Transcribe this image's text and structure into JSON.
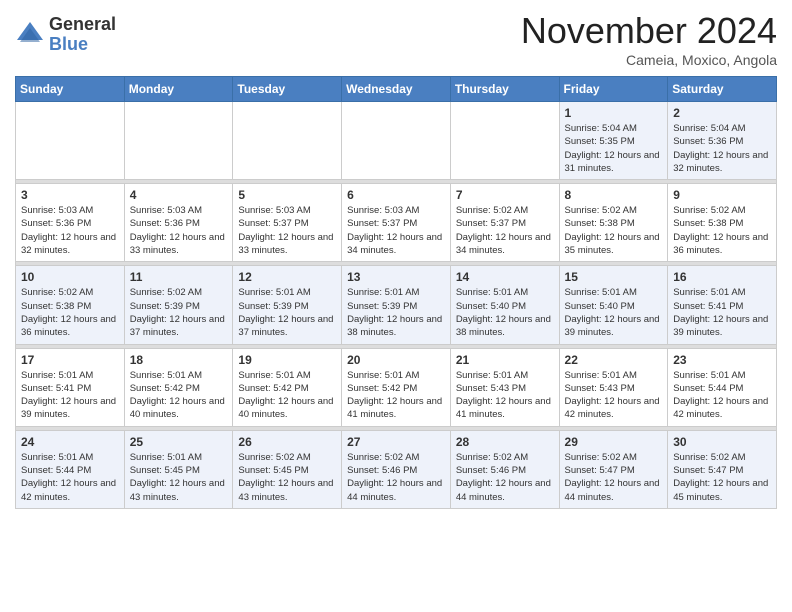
{
  "logo": {
    "general": "General",
    "blue": "Blue"
  },
  "title": "November 2024",
  "location": "Cameia, Moxico, Angola",
  "days_of_week": [
    "Sunday",
    "Monday",
    "Tuesday",
    "Wednesday",
    "Thursday",
    "Friday",
    "Saturday"
  ],
  "weeks": [
    [
      {
        "day": "",
        "info": ""
      },
      {
        "day": "",
        "info": ""
      },
      {
        "day": "",
        "info": ""
      },
      {
        "day": "",
        "info": ""
      },
      {
        "day": "",
        "info": ""
      },
      {
        "day": "1",
        "sunrise": "5:04 AM",
        "sunset": "5:35 PM",
        "daylight": "12 hours and 31 minutes."
      },
      {
        "day": "2",
        "sunrise": "5:04 AM",
        "sunset": "5:36 PM",
        "daylight": "12 hours and 32 minutes."
      }
    ],
    [
      {
        "day": "3",
        "sunrise": "5:03 AM",
        "sunset": "5:36 PM",
        "daylight": "12 hours and 32 minutes."
      },
      {
        "day": "4",
        "sunrise": "5:03 AM",
        "sunset": "5:36 PM",
        "daylight": "12 hours and 33 minutes."
      },
      {
        "day": "5",
        "sunrise": "5:03 AM",
        "sunset": "5:37 PM",
        "daylight": "12 hours and 33 minutes."
      },
      {
        "day": "6",
        "sunrise": "5:03 AM",
        "sunset": "5:37 PM",
        "daylight": "12 hours and 34 minutes."
      },
      {
        "day": "7",
        "sunrise": "5:02 AM",
        "sunset": "5:37 PM",
        "daylight": "12 hours and 34 minutes."
      },
      {
        "day": "8",
        "sunrise": "5:02 AM",
        "sunset": "5:38 PM",
        "daylight": "12 hours and 35 minutes."
      },
      {
        "day": "9",
        "sunrise": "5:02 AM",
        "sunset": "5:38 PM",
        "daylight": "12 hours and 36 minutes."
      }
    ],
    [
      {
        "day": "10",
        "sunrise": "5:02 AM",
        "sunset": "5:38 PM",
        "daylight": "12 hours and 36 minutes."
      },
      {
        "day": "11",
        "sunrise": "5:02 AM",
        "sunset": "5:39 PM",
        "daylight": "12 hours and 37 minutes."
      },
      {
        "day": "12",
        "sunrise": "5:01 AM",
        "sunset": "5:39 PM",
        "daylight": "12 hours and 37 minutes."
      },
      {
        "day": "13",
        "sunrise": "5:01 AM",
        "sunset": "5:39 PM",
        "daylight": "12 hours and 38 minutes."
      },
      {
        "day": "14",
        "sunrise": "5:01 AM",
        "sunset": "5:40 PM",
        "daylight": "12 hours and 38 minutes."
      },
      {
        "day": "15",
        "sunrise": "5:01 AM",
        "sunset": "5:40 PM",
        "daylight": "12 hours and 39 minutes."
      },
      {
        "day": "16",
        "sunrise": "5:01 AM",
        "sunset": "5:41 PM",
        "daylight": "12 hours and 39 minutes."
      }
    ],
    [
      {
        "day": "17",
        "sunrise": "5:01 AM",
        "sunset": "5:41 PM",
        "daylight": "12 hours and 39 minutes."
      },
      {
        "day": "18",
        "sunrise": "5:01 AM",
        "sunset": "5:42 PM",
        "daylight": "12 hours and 40 minutes."
      },
      {
        "day": "19",
        "sunrise": "5:01 AM",
        "sunset": "5:42 PM",
        "daylight": "12 hours and 40 minutes."
      },
      {
        "day": "20",
        "sunrise": "5:01 AM",
        "sunset": "5:42 PM",
        "daylight": "12 hours and 41 minutes."
      },
      {
        "day": "21",
        "sunrise": "5:01 AM",
        "sunset": "5:43 PM",
        "daylight": "12 hours and 41 minutes."
      },
      {
        "day": "22",
        "sunrise": "5:01 AM",
        "sunset": "5:43 PM",
        "daylight": "12 hours and 42 minutes."
      },
      {
        "day": "23",
        "sunrise": "5:01 AM",
        "sunset": "5:44 PM",
        "daylight": "12 hours and 42 minutes."
      }
    ],
    [
      {
        "day": "24",
        "sunrise": "5:01 AM",
        "sunset": "5:44 PM",
        "daylight": "12 hours and 42 minutes."
      },
      {
        "day": "25",
        "sunrise": "5:01 AM",
        "sunset": "5:45 PM",
        "daylight": "12 hours and 43 minutes."
      },
      {
        "day": "26",
        "sunrise": "5:02 AM",
        "sunset": "5:45 PM",
        "daylight": "12 hours and 43 minutes."
      },
      {
        "day": "27",
        "sunrise": "5:02 AM",
        "sunset": "5:46 PM",
        "daylight": "12 hours and 44 minutes."
      },
      {
        "day": "28",
        "sunrise": "5:02 AM",
        "sunset": "5:46 PM",
        "daylight": "12 hours and 44 minutes."
      },
      {
        "day": "29",
        "sunrise": "5:02 AM",
        "sunset": "5:47 PM",
        "daylight": "12 hours and 44 minutes."
      },
      {
        "day": "30",
        "sunrise": "5:02 AM",
        "sunset": "5:47 PM",
        "daylight": "12 hours and 45 minutes."
      }
    ]
  ],
  "labels": {
    "sunrise": "Sunrise:",
    "sunset": "Sunset:",
    "daylight": "Daylight:"
  }
}
